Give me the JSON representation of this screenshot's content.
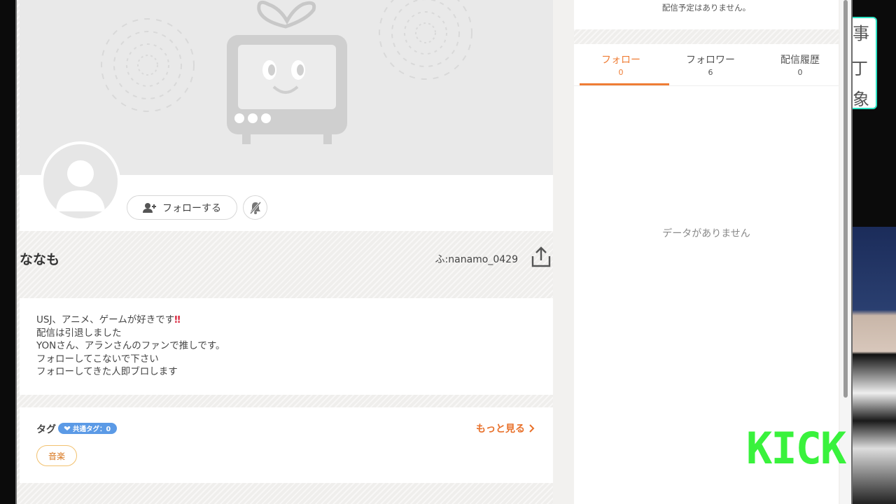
{
  "profile": {
    "follow_button_label": "フォローする",
    "name": "ななも",
    "user_id": "ふ:nanamo_0429"
  },
  "bio": {
    "lines": [
      "USJ、アニメ、ゲームが好きです",
      "配信は引退しました",
      "YONさん、アランさんのファンで推しです。",
      "フォローしてこないで下さい",
      "フォローしてきた人即ブロします"
    ],
    "line1_mark": "‼"
  },
  "tags": {
    "title": "タグ",
    "shared_badge": "共通タグ：0",
    "more_link": "もっと見る",
    "items": [
      "音楽"
    ]
  },
  "sidebar": {
    "schedule_text": "配信予定はありません。",
    "tabs": [
      {
        "label": "フォロー",
        "count": "0",
        "active": true
      },
      {
        "label": "フォロワー",
        "count": "6",
        "active": false
      },
      {
        "label": "配信履歴",
        "count": "0",
        "active": false
      }
    ],
    "empty_text": "データがありません"
  },
  "overlay": {
    "side_chars": [
      "事",
      "丁",
      "象"
    ],
    "kick_logo": "KICK"
  },
  "colors": {
    "accent": "#ef7d35",
    "badge": "#5b9ae6",
    "kick": "#39f23c"
  }
}
